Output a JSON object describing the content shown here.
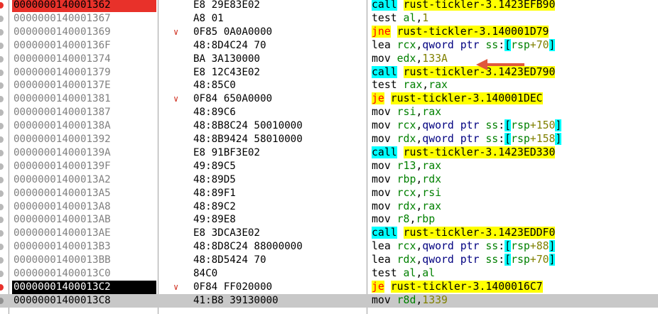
{
  "rows": [
    {
      "addr": "0000000140001362",
      "bytes": "E8 29E83E02",
      "bp": "red",
      "arrow": false,
      "tokens": [
        {
          "t": "call",
          "c": "hl-call"
        },
        {
          "t": " ",
          "c": ""
        },
        {
          "t": "rust-tickler-3.1423EFB90",
          "c": "hl-target"
        }
      ]
    },
    {
      "addr": "0000000140001367",
      "bytes": "A8 01",
      "bp": "",
      "arrow": false,
      "tokens": [
        {
          "t": "test ",
          "c": ""
        },
        {
          "t": "al",
          "c": "reg"
        },
        {
          "t": ",",
          "c": ""
        },
        {
          "t": "1",
          "c": "num"
        }
      ]
    },
    {
      "addr": "0000000140001369",
      "bytes": "0F85 0A0A0000",
      "bp": "",
      "arrow": true,
      "tokens": [
        {
          "t": "jne",
          "c": "hl-cjmp"
        },
        {
          "t": " ",
          "c": ""
        },
        {
          "t": "rust-tickler-3.140001D79",
          "c": "hl-target"
        }
      ]
    },
    {
      "addr": "000000014000136F",
      "bytes": "48:8D4C24 70",
      "bp": "",
      "arrow": false,
      "tokens": [
        {
          "t": "lea ",
          "c": ""
        },
        {
          "t": "rcx",
          "c": "reg"
        },
        {
          "t": ",",
          "c": ""
        },
        {
          "t": "qword ptr ",
          "c": "mem"
        },
        {
          "t": "ss",
          "c": "reg"
        },
        {
          "t": ":",
          "c": ""
        },
        {
          "t": "[",
          "c": "brk"
        },
        {
          "t": "rsp",
          "c": "reg"
        },
        {
          "t": "+70",
          "c": "num"
        },
        {
          "t": "]",
          "c": "brk"
        }
      ]
    },
    {
      "addr": "0000000140001374",
      "bytes": "BA 3A130000",
      "bp": "",
      "arrow": false,
      "tokens": [
        {
          "t": "mov ",
          "c": ""
        },
        {
          "t": "edx",
          "c": "reg"
        },
        {
          "t": ",",
          "c": ""
        },
        {
          "t": "133A",
          "c": "num"
        }
      ]
    },
    {
      "addr": "0000000140001379",
      "bytes": "E8 12C43E02",
      "bp": "",
      "arrow": false,
      "tokens": [
        {
          "t": "call",
          "c": "hl-call"
        },
        {
          "t": " ",
          "c": ""
        },
        {
          "t": "rust-tickler-3.1423ED790",
          "c": "hl-target"
        }
      ]
    },
    {
      "addr": "000000014000137E",
      "bytes": "48:85C0",
      "bp": "",
      "arrow": false,
      "tokens": [
        {
          "t": "test ",
          "c": ""
        },
        {
          "t": "rax",
          "c": "reg"
        },
        {
          "t": ",",
          "c": ""
        },
        {
          "t": "rax",
          "c": "reg"
        }
      ]
    },
    {
      "addr": "0000000140001381",
      "bytes": "0F84 650A0000",
      "bp": "",
      "arrow": true,
      "tokens": [
        {
          "t": "je",
          "c": "hl-cjmp"
        },
        {
          "t": " ",
          "c": ""
        },
        {
          "t": "rust-tickler-3.140001DEC",
          "c": "hl-target"
        }
      ]
    },
    {
      "addr": "0000000140001387",
      "bytes": "48:89C6",
      "bp": "",
      "arrow": false,
      "tokens": [
        {
          "t": "mov ",
          "c": ""
        },
        {
          "t": "rsi",
          "c": "reg"
        },
        {
          "t": ",",
          "c": ""
        },
        {
          "t": "rax",
          "c": "reg"
        }
      ]
    },
    {
      "addr": "000000014000138A",
      "bytes": "48:8B8C24 50010000",
      "bp": "",
      "arrow": false,
      "tokens": [
        {
          "t": "mov ",
          "c": ""
        },
        {
          "t": "rcx",
          "c": "reg"
        },
        {
          "t": ",",
          "c": ""
        },
        {
          "t": "qword ptr ",
          "c": "mem"
        },
        {
          "t": "ss",
          "c": "reg"
        },
        {
          "t": ":",
          "c": ""
        },
        {
          "t": "[",
          "c": "brk"
        },
        {
          "t": "rsp",
          "c": "reg"
        },
        {
          "t": "+150",
          "c": "num"
        },
        {
          "t": "]",
          "c": "brk"
        }
      ]
    },
    {
      "addr": "0000000140001392",
      "bytes": "48:8B9424 58010000",
      "bp": "",
      "arrow": false,
      "tokens": [
        {
          "t": "mov ",
          "c": ""
        },
        {
          "t": "rdx",
          "c": "reg"
        },
        {
          "t": ",",
          "c": ""
        },
        {
          "t": "qword ptr ",
          "c": "mem"
        },
        {
          "t": "ss",
          "c": "reg"
        },
        {
          "t": ":",
          "c": ""
        },
        {
          "t": "[",
          "c": "brk"
        },
        {
          "t": "rsp",
          "c": "reg"
        },
        {
          "t": "+158",
          "c": "num"
        },
        {
          "t": "]",
          "c": "brk"
        }
      ]
    },
    {
      "addr": "000000014000139A",
      "bytes": "E8 91BF3E02",
      "bp": "",
      "arrow": false,
      "tokens": [
        {
          "t": "call",
          "c": "hl-call"
        },
        {
          "t": " ",
          "c": ""
        },
        {
          "t": "rust-tickler-3.1423ED330",
          "c": "hl-target"
        }
      ]
    },
    {
      "addr": "000000014000139F",
      "bytes": "49:89C5",
      "bp": "",
      "arrow": false,
      "tokens": [
        {
          "t": "mov ",
          "c": ""
        },
        {
          "t": "r13",
          "c": "reg"
        },
        {
          "t": ",",
          "c": ""
        },
        {
          "t": "rax",
          "c": "reg"
        }
      ]
    },
    {
      "addr": "00000001400013A2",
      "bytes": "48:89D5",
      "bp": "",
      "arrow": false,
      "tokens": [
        {
          "t": "mov ",
          "c": ""
        },
        {
          "t": "rbp",
          "c": "reg"
        },
        {
          "t": ",",
          "c": ""
        },
        {
          "t": "rdx",
          "c": "reg"
        }
      ]
    },
    {
      "addr": "00000001400013A5",
      "bytes": "48:89F1",
      "bp": "",
      "arrow": false,
      "tokens": [
        {
          "t": "mov ",
          "c": ""
        },
        {
          "t": "rcx",
          "c": "reg"
        },
        {
          "t": ",",
          "c": ""
        },
        {
          "t": "rsi",
          "c": "reg"
        }
      ]
    },
    {
      "addr": "00000001400013A8",
      "bytes": "48:89C2",
      "bp": "",
      "arrow": false,
      "tokens": [
        {
          "t": "mov ",
          "c": ""
        },
        {
          "t": "rdx",
          "c": "reg"
        },
        {
          "t": ",",
          "c": ""
        },
        {
          "t": "rax",
          "c": "reg"
        }
      ]
    },
    {
      "addr": "00000001400013AB",
      "bytes": "49:89E8",
      "bp": "",
      "arrow": false,
      "tokens": [
        {
          "t": "mov ",
          "c": ""
        },
        {
          "t": "r8",
          "c": "reg"
        },
        {
          "t": ",",
          "c": ""
        },
        {
          "t": "rbp",
          "c": "reg"
        }
      ]
    },
    {
      "addr": "00000001400013AE",
      "bytes": "E8 3DCA3E02",
      "bp": "",
      "arrow": false,
      "tokens": [
        {
          "t": "call",
          "c": "hl-call"
        },
        {
          "t": " ",
          "c": ""
        },
        {
          "t": "rust-tickler-3.1423EDDF0",
          "c": "hl-target"
        }
      ]
    },
    {
      "addr": "00000001400013B3",
      "bytes": "48:8D8C24 88000000",
      "bp": "",
      "arrow": false,
      "tokens": [
        {
          "t": "lea ",
          "c": ""
        },
        {
          "t": "rcx",
          "c": "reg"
        },
        {
          "t": ",",
          "c": ""
        },
        {
          "t": "qword ptr ",
          "c": "mem"
        },
        {
          "t": "ss",
          "c": "reg"
        },
        {
          "t": ":",
          "c": ""
        },
        {
          "t": "[",
          "c": "brk"
        },
        {
          "t": "rsp",
          "c": "reg"
        },
        {
          "t": "+88",
          "c": "num"
        },
        {
          "t": "]",
          "c": "brk"
        }
      ]
    },
    {
      "addr": "00000001400013BB",
      "bytes": "48:8D5424 70",
      "bp": "",
      "arrow": false,
      "tokens": [
        {
          "t": "lea ",
          "c": ""
        },
        {
          "t": "rdx",
          "c": "reg"
        },
        {
          "t": ",",
          "c": ""
        },
        {
          "t": "qword ptr ",
          "c": "mem"
        },
        {
          "t": "ss",
          "c": "reg"
        },
        {
          "t": ":",
          "c": ""
        },
        {
          "t": "[",
          "c": "brk"
        },
        {
          "t": "rsp",
          "c": "reg"
        },
        {
          "t": "+70",
          "c": "num"
        },
        {
          "t": "]",
          "c": "brk"
        }
      ]
    },
    {
      "addr": "00000001400013C0",
      "bytes": "84C0",
      "bp": "",
      "arrow": false,
      "tokens": [
        {
          "t": "test ",
          "c": ""
        },
        {
          "t": "al",
          "c": "reg"
        },
        {
          "t": ",",
          "c": ""
        },
        {
          "t": "al",
          "c": "reg"
        }
      ]
    },
    {
      "addr": "00000001400013C2",
      "bytes": "0F84 FF020000",
      "bp": "black",
      "arrow": true,
      "tokens": [
        {
          "t": "je",
          "c": "hl-cjmp"
        },
        {
          "t": " ",
          "c": ""
        },
        {
          "t": "rust-tickler-3.1400016C7",
          "c": "hl-target"
        }
      ]
    },
    {
      "addr": "00000001400013C8",
      "bytes": "41:B8 39130000",
      "bp": "",
      "current": true,
      "arrow": false,
      "tokens": [
        {
          "t": "mov ",
          "c": ""
        },
        {
          "t": "r8d",
          "c": "reg"
        },
        {
          "t": ",",
          "c": ""
        },
        {
          "t": "1339",
          "c": "num"
        }
      ]
    }
  ],
  "colors": {
    "breakpoint": "#e8312a",
    "call_highlight": "#00ffff",
    "jump_highlight": "#ffff00",
    "register": "#008000",
    "number": "#808000",
    "annotation_arrow": "#e0583c"
  }
}
